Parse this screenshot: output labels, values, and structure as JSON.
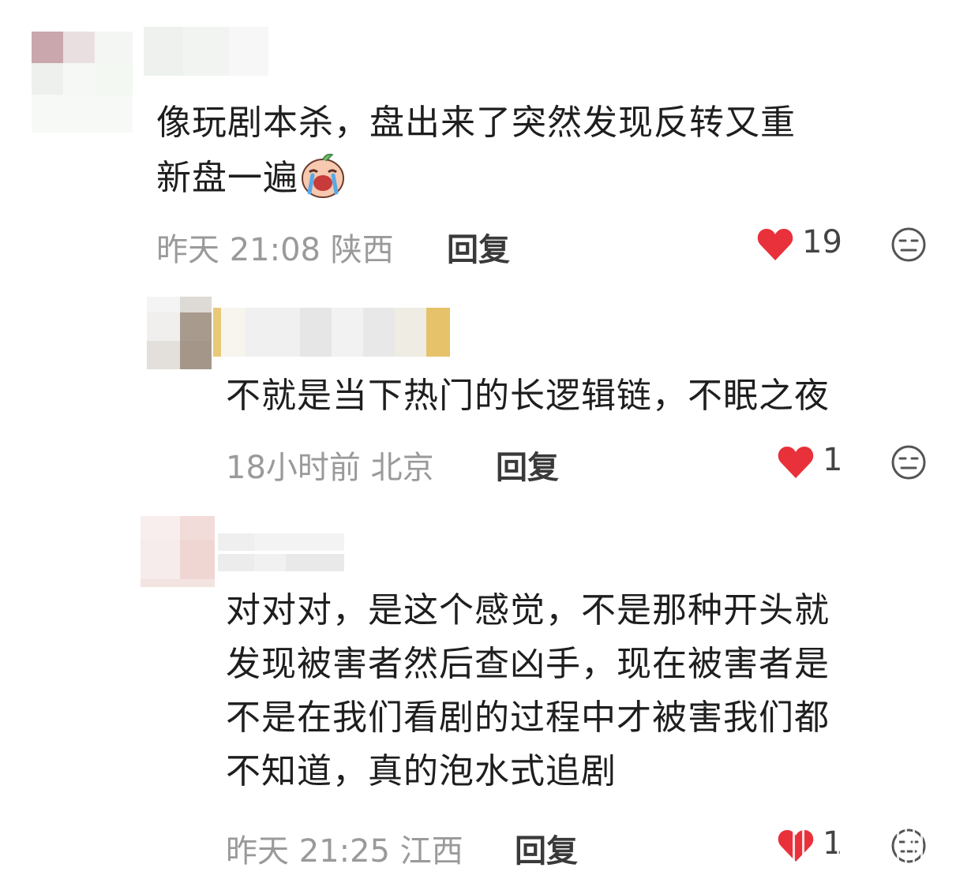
{
  "comments": [
    {
      "text_lines": [
        "像玩剧本杀，盘出来了突然发现反转又重",
        "新盘一遍"
      ],
      "emoji": "crying-face-emoji",
      "time": "昨天 21:08",
      "location": "陕西",
      "reply_label": "回复",
      "likes": "19"
    },
    {
      "text_lines": [
        "不就是当下热门的长逻辑链，不眠之夜"
      ],
      "time": "18小时前",
      "location": "北京",
      "reply_label": "回复",
      "likes": "1"
    },
    {
      "text_lines": [
        "对对对，是这个感觉，不是那种开头就",
        "发现被害者然后查凶手，现在被害者是",
        "不是在我们看剧的过程中才被害我们都",
        "不知道，真的泡水式追剧"
      ],
      "time": "昨天 21:25",
      "location": "江西",
      "reply_label": "回复",
      "likes": "1"
    }
  ],
  "colors": {
    "heart": "#e8313a",
    "meta": "#9a9a9a",
    "text": "#1e1e1e"
  }
}
